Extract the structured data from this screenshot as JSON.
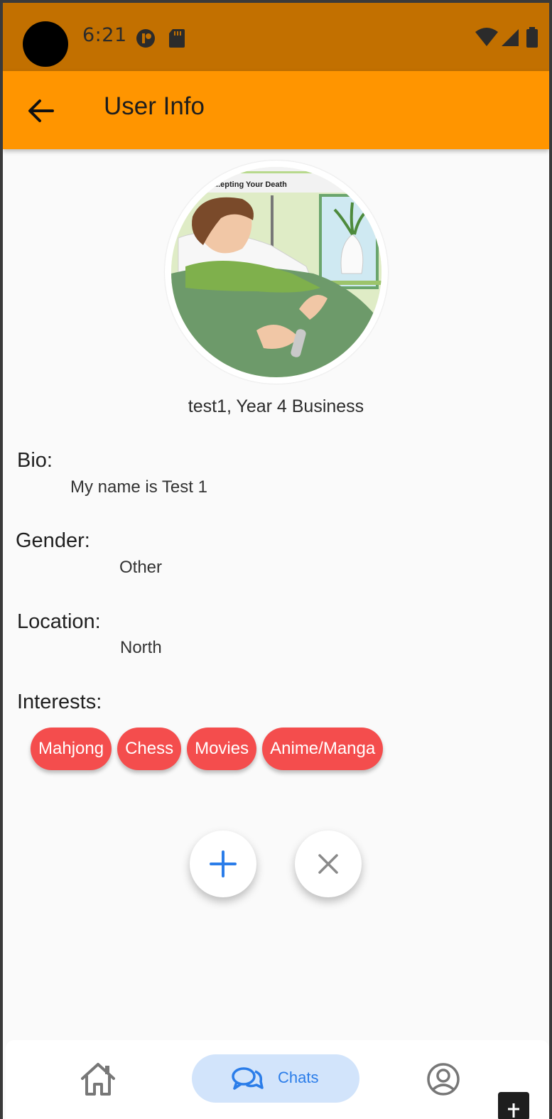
{
  "status_bar": {
    "time": "6:21"
  },
  "app_bar": {
    "title": "User Info"
  },
  "profile": {
    "name_line": "test1, Year 4 Business",
    "avatar_caption": "...epting Your Death"
  },
  "fields": {
    "bio_label": "Bio:",
    "bio_value": "My name is Test 1",
    "gender_label": "Gender:",
    "gender_value": "Other",
    "location_label": "Location:",
    "location_value": "North",
    "interests_label": "Interests:"
  },
  "interests": [
    "Mahjong",
    "Chess",
    "Movies",
    "Anime/Manga"
  ],
  "actions": {
    "add_icon": "plus-icon",
    "dismiss_icon": "close-icon"
  },
  "bottom_nav": {
    "home_icon": "home-icon",
    "chats_label": "Chats",
    "profile_icon": "account-circle-icon"
  },
  "colors": {
    "status_bar": "#c27000",
    "app_bar": "#ff9500",
    "chip": "#f44d4d",
    "accent_blue": "#2b7de9",
    "nav_pill": "#d2e4fb"
  }
}
